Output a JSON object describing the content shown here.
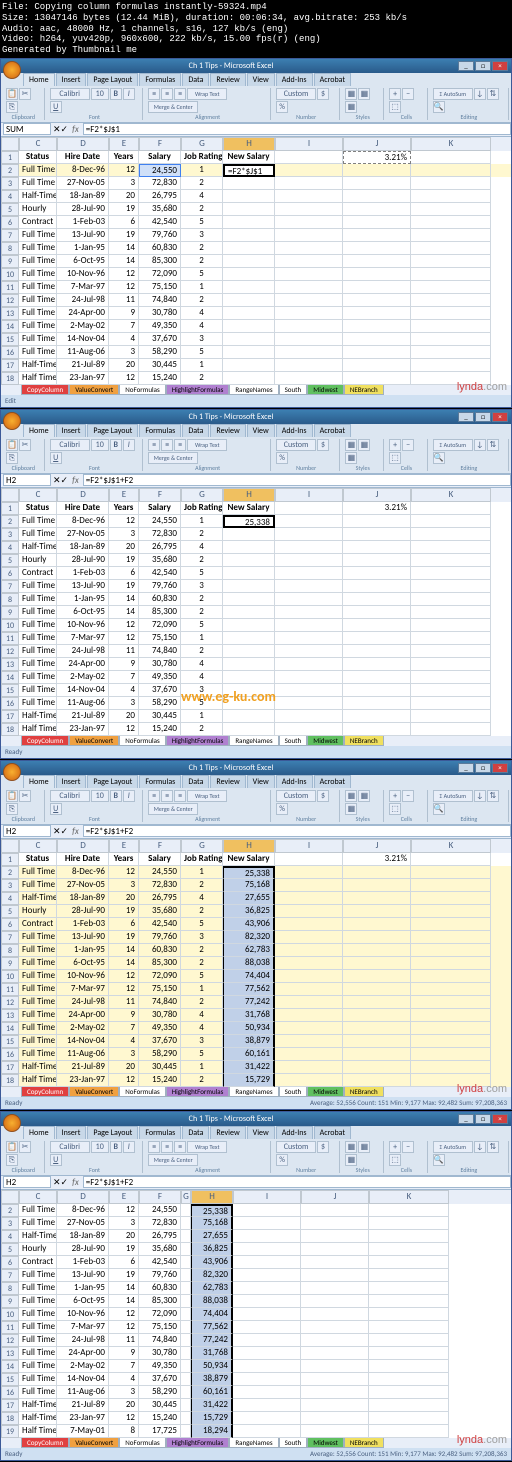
{
  "meta": {
    "l1": "File: Copying column formulas instantly-59324.mp4",
    "l2": "Size: 13047146 bytes (12.44 MiB), duration: 00:06:34, avg.bitrate: 253 kb/s",
    "l3": "Audio: aac, 48000 Hz, 1 channels, s16, 127 kb/s (eng)",
    "l4": "Video: h264, yuv420p, 960x600, 222 kb/s, 15.00 fps(r) (eng)",
    "l5": "Generated by Thumbnail me"
  },
  "title": "Ch 1 Tips - Microsoft Excel",
  "tabs": [
    "Home",
    "Insert",
    "Page Layout",
    "Formulas",
    "Data",
    "Review",
    "View",
    "Add-Ins",
    "Acrobat"
  ],
  "rib": {
    "clipboard": "Clipboard",
    "font": "Font",
    "alignment": "Alignment",
    "number": "Number",
    "styles": "Styles",
    "cells": "Cells",
    "editing": "Editing",
    "fontname": "Calibri",
    "fontsize": "10",
    "numfmt": "Custom"
  },
  "p1": {
    "namebox": "SUM",
    "formula": "=F2*$J$1",
    "j1": "3.21%",
    "headers": {
      "c": "Status",
      "d": "Hire Date",
      "e": "Years",
      "f": "Salary",
      "g": "Job Rating",
      "h": "New Salary"
    },
    "h2": "=F2*$J$1",
    "rows": [
      {
        "n": "2",
        "c": "Full Time",
        "d": "8-Dec-96",
        "e": "12",
        "f": "24,550",
        "g": "1"
      },
      {
        "n": "3",
        "c": "Full Time",
        "d": "27-Nov-05",
        "e": "3",
        "f": "72,830",
        "g": "2"
      },
      {
        "n": "4",
        "c": "Half-Time",
        "d": "18-Jan-89",
        "e": "20",
        "f": "26,795",
        "g": "4"
      },
      {
        "n": "5",
        "c": "Hourly",
        "d": "28-Jul-90",
        "e": "19",
        "f": "35,680",
        "g": "2"
      },
      {
        "n": "6",
        "c": "Contract",
        "d": "1-Feb-03",
        "e": "6",
        "f": "42,540",
        "g": "5"
      },
      {
        "n": "7",
        "c": "Full Time",
        "d": "13-Jul-90",
        "e": "19",
        "f": "79,760",
        "g": "3"
      },
      {
        "n": "8",
        "c": "Full Time",
        "d": "1-Jan-95",
        "e": "14",
        "f": "60,830",
        "g": "2"
      },
      {
        "n": "9",
        "c": "Full Time",
        "d": "6-Oct-95",
        "e": "14",
        "f": "85,300",
        "g": "2"
      },
      {
        "n": "10",
        "c": "Full Time",
        "d": "10-Nov-96",
        "e": "12",
        "f": "72,090",
        "g": "5"
      },
      {
        "n": "11",
        "c": "Full Time",
        "d": "7-Mar-97",
        "e": "12",
        "f": "75,150",
        "g": "1"
      },
      {
        "n": "12",
        "c": "Full Time",
        "d": "24-Jul-98",
        "e": "11",
        "f": "74,840",
        "g": "2"
      },
      {
        "n": "13",
        "c": "Full Time",
        "d": "24-Apr-00",
        "e": "9",
        "f": "30,780",
        "g": "4"
      },
      {
        "n": "14",
        "c": "Full Time",
        "d": "2-May-02",
        "e": "7",
        "f": "49,350",
        "g": "4"
      },
      {
        "n": "15",
        "c": "Full Time",
        "d": "14-Nov-04",
        "e": "4",
        "f": "37,670",
        "g": "3"
      },
      {
        "n": "16",
        "c": "Full Time",
        "d": "11-Aug-06",
        "e": "3",
        "f": "58,290",
        "g": "5"
      },
      {
        "n": "17",
        "c": "Half-Time",
        "d": "21-Jul-89",
        "e": "20",
        "f": "30,445",
        "g": "1"
      },
      {
        "n": "18",
        "c": "Half Time",
        "d": "23-Jan-97",
        "e": "12",
        "f": "15,240",
        "g": "2"
      }
    ]
  },
  "p2": {
    "namebox": "H2",
    "formula": "=F2*$J$1+F2",
    "j1": "3.21%",
    "h2": "25,338",
    "rows": [
      {
        "n": "2",
        "c": "Full Time",
        "d": "8-Dec-96",
        "e": "12",
        "f": "24,550",
        "g": "1"
      },
      {
        "n": "3",
        "c": "Full Time",
        "d": "27-Nov-05",
        "e": "3",
        "f": "72,830",
        "g": "2"
      },
      {
        "n": "4",
        "c": "Half-Time",
        "d": "18-Jan-89",
        "e": "20",
        "f": "26,795",
        "g": "4"
      },
      {
        "n": "5",
        "c": "Hourly",
        "d": "28-Jul-90",
        "e": "19",
        "f": "35,680",
        "g": "2"
      },
      {
        "n": "6",
        "c": "Contract",
        "d": "1-Feb-03",
        "e": "6",
        "f": "42,540",
        "g": "5"
      },
      {
        "n": "7",
        "c": "Full Time",
        "d": "13-Jul-90",
        "e": "19",
        "f": "79,760",
        "g": "3"
      },
      {
        "n": "8",
        "c": "Full Time",
        "d": "1-Jan-95",
        "e": "14",
        "f": "60,830",
        "g": "2"
      },
      {
        "n": "9",
        "c": "Full Time",
        "d": "6-Oct-95",
        "e": "14",
        "f": "85,300",
        "g": "2"
      },
      {
        "n": "10",
        "c": "Full Time",
        "d": "10-Nov-96",
        "e": "12",
        "f": "72,090",
        "g": "5"
      },
      {
        "n": "11",
        "c": "Full Time",
        "d": "7-Mar-97",
        "e": "12",
        "f": "75,150",
        "g": "1"
      },
      {
        "n": "12",
        "c": "Full Time",
        "d": "24-Jul-98",
        "e": "11",
        "f": "74,840",
        "g": "2"
      },
      {
        "n": "13",
        "c": "Full Time",
        "d": "24-Apr-00",
        "e": "9",
        "f": "30,780",
        "g": "4"
      },
      {
        "n": "14",
        "c": "Full Time",
        "d": "2-May-02",
        "e": "7",
        "f": "49,350",
        "g": "4"
      },
      {
        "n": "15",
        "c": "Full Time",
        "d": "14-Nov-04",
        "e": "4",
        "f": "37,670",
        "g": "3"
      },
      {
        "n": "16",
        "c": "Full Time",
        "d": "11-Aug-06",
        "e": "3",
        "f": "58,290",
        "g": "5"
      },
      {
        "n": "17",
        "c": "Half-Time",
        "d": "21-Jul-89",
        "e": "20",
        "f": "30,445",
        "g": "1"
      },
      {
        "n": "18",
        "c": "Half Time",
        "d": "23-Jan-97",
        "e": "12",
        "f": "15,240",
        "g": "2"
      }
    ]
  },
  "p3": {
    "namebox": "H2",
    "formula": "=F2*$J$1+F2",
    "j1": "3.21%",
    "rows": [
      {
        "n": "2",
        "c": "Full Time",
        "d": "8-Dec-96",
        "e": "12",
        "f": "24,550",
        "g": "1",
        "h": "25,338"
      },
      {
        "n": "3",
        "c": "Full Time",
        "d": "27-Nov-05",
        "e": "3",
        "f": "72,830",
        "g": "2",
        "h": "75,168"
      },
      {
        "n": "4",
        "c": "Half-Time",
        "d": "18-Jan-89",
        "e": "20",
        "f": "26,795",
        "g": "4",
        "h": "27,655"
      },
      {
        "n": "5",
        "c": "Hourly",
        "d": "28-Jul-90",
        "e": "19",
        "f": "35,680",
        "g": "2",
        "h": "36,825"
      },
      {
        "n": "6",
        "c": "Contract",
        "d": "1-Feb-03",
        "e": "6",
        "f": "42,540",
        "g": "5",
        "h": "43,906"
      },
      {
        "n": "7",
        "c": "Full Time",
        "d": "13-Jul-90",
        "e": "19",
        "f": "79,760",
        "g": "3",
        "h": "82,320"
      },
      {
        "n": "8",
        "c": "Full Time",
        "d": "1-Jan-95",
        "e": "14",
        "f": "60,830",
        "g": "2",
        "h": "62,783"
      },
      {
        "n": "9",
        "c": "Full Time",
        "d": "6-Oct-95",
        "e": "14",
        "f": "85,300",
        "g": "2",
        "h": "88,038"
      },
      {
        "n": "10",
        "c": "Full Time",
        "d": "10-Nov-96",
        "e": "12",
        "f": "72,090",
        "g": "5",
        "h": "74,404"
      },
      {
        "n": "11",
        "c": "Full Time",
        "d": "7-Mar-97",
        "e": "12",
        "f": "75,150",
        "g": "1",
        "h": "77,562"
      },
      {
        "n": "12",
        "c": "Full Time",
        "d": "24-Jul-98",
        "e": "11",
        "f": "74,840",
        "g": "2",
        "h": "77,242"
      },
      {
        "n": "13",
        "c": "Full Time",
        "d": "24-Apr-00",
        "e": "9",
        "f": "30,780",
        "g": "4",
        "h": "31,768"
      },
      {
        "n": "14",
        "c": "Full Time",
        "d": "2-May-02",
        "e": "7",
        "f": "49,350",
        "g": "4",
        "h": "50,934"
      },
      {
        "n": "15",
        "c": "Full Time",
        "d": "14-Nov-04",
        "e": "4",
        "f": "37,670",
        "g": "3",
        "h": "38,879"
      },
      {
        "n": "16",
        "c": "Full Time",
        "d": "11-Aug-06",
        "e": "3",
        "f": "58,290",
        "g": "5",
        "h": "60,161"
      },
      {
        "n": "17",
        "c": "Half-Time",
        "d": "21-Jul-89",
        "e": "20",
        "f": "30,445",
        "g": "1",
        "h": "31,422"
      },
      {
        "n": "18",
        "c": "Half Time",
        "d": "23-Jan-97",
        "e": "12",
        "f": "15,240",
        "g": "2",
        "h": "15,729"
      }
    ],
    "status": "Average: 52,556    Count: 151    Min: 9,177    Max: 92,482    Sum: 97,208,363"
  },
  "p4": {
    "namebox": "H2",
    "formula": "=F2*$J$1+F2",
    "rows": [
      {
        "n": "2",
        "c": "Full Time",
        "d": "8-Dec-96",
        "e": "12",
        "f": "24,550",
        "h": "25,338"
      },
      {
        "n": "3",
        "c": "Full Time",
        "d": "27-Nov-05",
        "e": "3",
        "f": "72,830",
        "h": "75,168"
      },
      {
        "n": "4",
        "c": "Half-Time",
        "d": "18-Jan-89",
        "e": "20",
        "f": "26,795",
        "h": "27,655"
      },
      {
        "n": "5",
        "c": "Hourly",
        "d": "28-Jul-90",
        "e": "19",
        "f": "35,680",
        "h": "36,825"
      },
      {
        "n": "6",
        "c": "Contract",
        "d": "1-Feb-03",
        "e": "6",
        "f": "42,540",
        "h": "43,906"
      },
      {
        "n": "7",
        "c": "Full Time",
        "d": "13-Jul-90",
        "e": "19",
        "f": "79,760",
        "h": "82,320"
      },
      {
        "n": "8",
        "c": "Full Time",
        "d": "1-Jan-95",
        "e": "14",
        "f": "60,830",
        "h": "62,783"
      },
      {
        "n": "9",
        "c": "Full Time",
        "d": "6-Oct-95",
        "e": "14",
        "f": "85,300",
        "h": "88,038"
      },
      {
        "n": "10",
        "c": "Full Time",
        "d": "10-Nov-96",
        "e": "12",
        "f": "72,090",
        "h": "74,404"
      },
      {
        "n": "11",
        "c": "Full Time",
        "d": "7-Mar-97",
        "e": "12",
        "f": "75,150",
        "h": "77,562"
      },
      {
        "n": "12",
        "c": "Full Time",
        "d": "24-Jul-98",
        "e": "11",
        "f": "74,840",
        "h": "77,242"
      },
      {
        "n": "13",
        "c": "Full Time",
        "d": "24-Apr-00",
        "e": "9",
        "f": "30,780",
        "h": "31,768"
      },
      {
        "n": "14",
        "c": "Full Time",
        "d": "2-May-02",
        "e": "7",
        "f": "49,350",
        "h": "50,934"
      },
      {
        "n": "15",
        "c": "Full Time",
        "d": "14-Nov-04",
        "e": "4",
        "f": "37,670",
        "h": "38,879"
      },
      {
        "n": "16",
        "c": "Full Time",
        "d": "11-Aug-06",
        "e": "3",
        "f": "58,290",
        "h": "60,161"
      },
      {
        "n": "17",
        "c": "Half-Time",
        "d": "21-Jul-89",
        "e": "20",
        "f": "30,445",
        "h": "31,422"
      },
      {
        "n": "18",
        "c": "Half-Time",
        "d": "23-Jan-97",
        "e": "12",
        "f": "15,240",
        "h": "15,729"
      },
      {
        "n": "19",
        "c": "Half Time",
        "d": "7-May-01",
        "e": "8",
        "f": "17,725",
        "h": "18,294"
      }
    ],
    "status": "Average: 52,556    Count: 151    Min: 9,177    Max: 92,482    Sum: 97,208,363"
  },
  "sheettabs": [
    "CopyColumn",
    "ValueConvert",
    "NoFormulas",
    "HighlightFormulas",
    "RangeNames",
    "South",
    "Midwest",
    "NEBranch"
  ],
  "egku": "www.eg-ku.com",
  "lynda": {
    "a": "lynda",
    "b": ".com"
  },
  "ready": "Ready",
  "edit": "Edit"
}
